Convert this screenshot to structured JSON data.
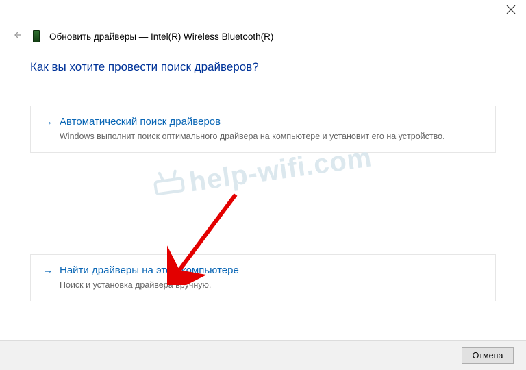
{
  "window": {
    "title": "Обновить драйверы — Intel(R) Wireless Bluetooth(R)"
  },
  "heading": "Как вы хотите провести поиск драйверов?",
  "options": [
    {
      "title": "Автоматический поиск драйверов",
      "desc": "Windows выполнит поиск оптимального драйвера на компьютере и установит его на устройство."
    },
    {
      "title": "Найти драйверы на этом компьютере",
      "desc": "Поиск и установка драйвера вручную."
    }
  ],
  "buttons": {
    "cancel": "Отмена"
  },
  "watermark": "help-wifi.com"
}
